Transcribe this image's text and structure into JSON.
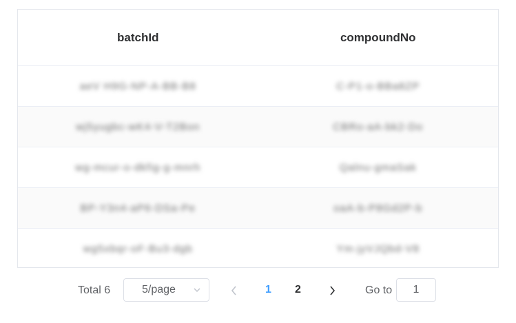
{
  "table": {
    "columns": [
      "batchId",
      "compoundNo"
    ],
    "rows": [
      [
        "aeV H9G-NP-A-BB-B8",
        "C-P1-o-BBa8ZP"
      ],
      [
        "wj5yugbc-wK4-V-T2Bon",
        "CBRo-aA-bk2-Do"
      ],
      [
        "wg-mcur-o-dkfig-g-mnrh",
        "Qalnu-gmaSak"
      ],
      [
        "BP-Y3n4-aP6-DSa-Pe",
        "oaA-b-P8Gd2P-b"
      ],
      [
        "wg5xbqr-oF-Bu3-dgb",
        "Ym-jyVJQbd-V8"
      ]
    ]
  },
  "pagination": {
    "total": "Total 6",
    "page_size": "5/page",
    "pages": [
      "1",
      "2"
    ],
    "active_page": "1",
    "goto_label": "Go to",
    "goto_value": "1"
  }
}
